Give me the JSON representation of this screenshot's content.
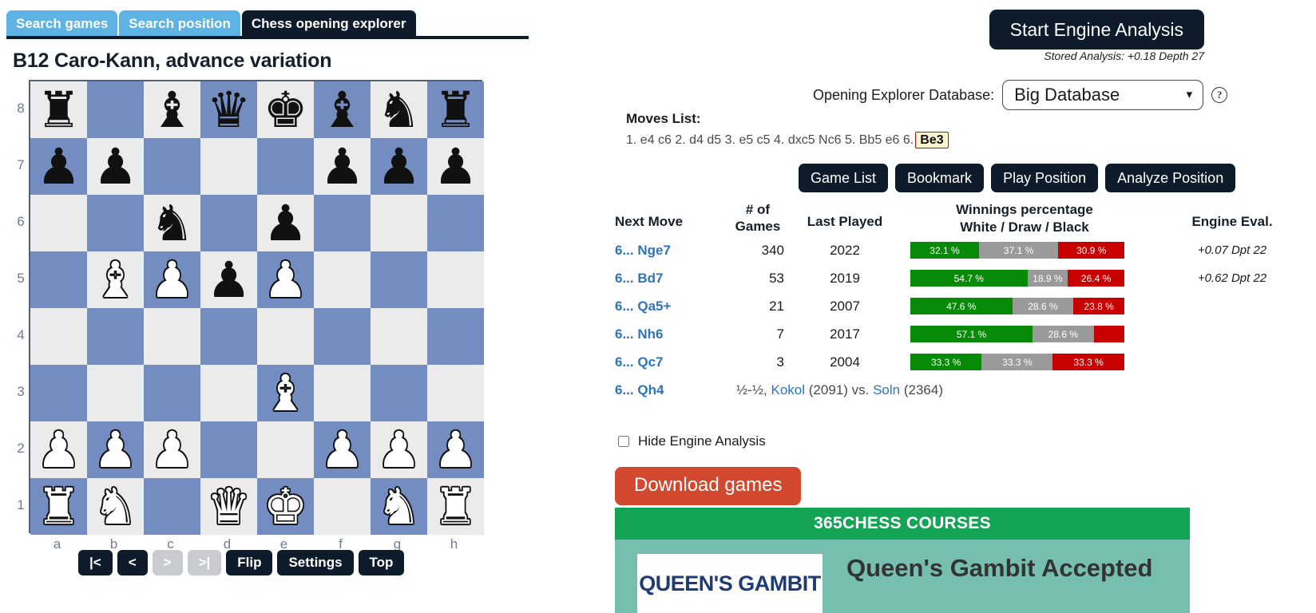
{
  "tabs": [
    {
      "label": "Search games",
      "active": false
    },
    {
      "label": "Search position",
      "active": false
    },
    {
      "label": "Chess opening explorer",
      "active": true
    }
  ],
  "page_title": "B12 Caro-Kann, advance variation",
  "board": {
    "ranks": [
      "8",
      "7",
      "6",
      "5",
      "4",
      "3",
      "2",
      "1"
    ],
    "files": [
      "a",
      "b",
      "c",
      "d",
      "e",
      "f",
      "g",
      "h"
    ],
    "rows": [
      [
        "r",
        "",
        "b",
        "q",
        "k",
        "b",
        "n",
        "r"
      ],
      [
        "p",
        "p",
        "",
        "",
        "",
        "p",
        "p",
        "p"
      ],
      [
        "",
        "",
        "n",
        "",
        "p",
        "",
        "",
        ""
      ],
      [
        "",
        "B",
        "P",
        "p",
        "P",
        "",
        "",
        ""
      ],
      [
        "",
        "",
        "",
        "",
        "",
        "",
        "",
        ""
      ],
      [
        "",
        "",
        "",
        "",
        "B",
        "",
        "",
        ""
      ],
      [
        "P",
        "P",
        "P",
        "",
        "",
        "P",
        "P",
        "P"
      ],
      [
        "R",
        "N",
        "",
        "Q",
        "K",
        "",
        "N",
        "R"
      ]
    ],
    "nav": [
      {
        "label": "|<",
        "disabled": false
      },
      {
        "label": "<",
        "disabled": false
      },
      {
        "label": ">",
        "disabled": true
      },
      {
        "label": ">|",
        "disabled": true
      },
      {
        "label": "Flip",
        "disabled": false
      },
      {
        "label": "Settings",
        "disabled": false
      },
      {
        "label": "Top",
        "disabled": false
      }
    ]
  },
  "engine": {
    "start_button": "Start Engine Analysis",
    "stored_analysis": "Stored Analysis: +0.18 Depth 27"
  },
  "database": {
    "label": "Opening Explorer Database:",
    "selected": "Big Database",
    "options": [
      "Big Database"
    ],
    "chevron": "▾",
    "help": "?"
  },
  "moves": {
    "label": "Moves List:",
    "prefix": "1. e4 c6 2. d4 d5 3. e5 c5 4. dxc5 Nc6 5. Bb5 e6 6.",
    "current": "Be3"
  },
  "actions": [
    "Game List",
    "Bookmark",
    "Play Position",
    "Analyze Position"
  ],
  "table": {
    "headers": {
      "next_move": "Next Move",
      "games_line1": "# of",
      "games_line2": "Games",
      "last_played": "Last Played",
      "win_line1": "Winnings percentage",
      "win_line2": "White / Draw / Black",
      "engine_eval": "Engine Eval."
    },
    "rows": [
      {
        "move_num": "6...",
        "move": "Nge7",
        "games": "340",
        "last_played": "2022",
        "white": 32.1,
        "draw": 37.1,
        "black": 30.9,
        "white_label": "32.1 %",
        "draw_label": "37.1 %",
        "black_label": "30.9 %",
        "eval": "+0.07 Dpt 22"
      },
      {
        "move_num": "6...",
        "move": "Bd7",
        "games": "53",
        "last_played": "2019",
        "white": 54.7,
        "draw": 18.9,
        "black": 26.4,
        "white_label": "54.7 %",
        "draw_label": "18.9 %",
        "black_label": "26.4 %",
        "eval": "+0.62 Dpt 22"
      },
      {
        "move_num": "6...",
        "move": "Qa5+",
        "games": "21",
        "last_played": "2007",
        "white": 47.6,
        "draw": 28.6,
        "black": 23.8,
        "white_label": "47.6 %",
        "draw_label": "28.6 %",
        "black_label": "23.8 %",
        "eval": ""
      },
      {
        "move_num": "6...",
        "move": "Nh6",
        "games": "7",
        "last_played": "2017",
        "white": 57.1,
        "draw": 28.6,
        "black": 14.3,
        "white_label": "57.1 %",
        "draw_label": "28.6 %",
        "black_label": "",
        "eval": ""
      },
      {
        "move_num": "6...",
        "move": "Qc7",
        "games": "3",
        "last_played": "2004",
        "white": 33.3,
        "draw": 33.3,
        "black": 33.3,
        "white_label": "33.3 %",
        "draw_label": "33.3 %",
        "black_label": "33.3 %",
        "eval": ""
      }
    ],
    "single_game_row": {
      "move_num": "6...",
      "move": "Qh4",
      "result": "½-½,",
      "white_player": "Kokol",
      "white_rating": "(2091)",
      "vs": "vs.",
      "black_player": "Soln",
      "black_rating": "(2364)"
    }
  },
  "hide_engine": {
    "label": "Hide Engine Analysis",
    "checked": false
  },
  "download_button": "Download games",
  "courses": {
    "header": "365CHESS COURSES",
    "thumb_text": "QUEEN'S GAMBIT",
    "title": "Queen's Gambit Accepted"
  },
  "colors": {
    "nav_dark": "#0d1b2a",
    "tab_blue": "#5cb3e4",
    "link_blue": "#2f73b8",
    "win_green": "#078a07",
    "draw_gray": "#9a9a9a",
    "loss_red": "#c80000",
    "download_red": "#d2492f",
    "courses_green": "#13a456",
    "board_dark": "#748dc1",
    "board_light": "#ebebeb"
  }
}
